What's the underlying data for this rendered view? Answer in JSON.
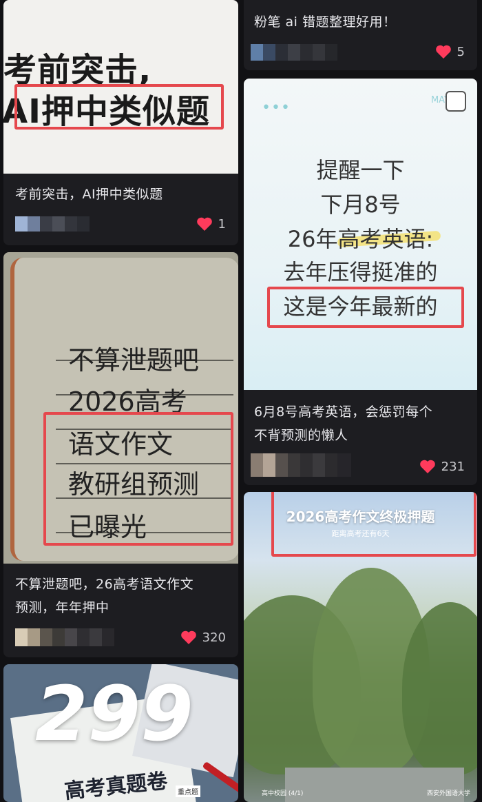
{
  "colors": {
    "background": "#111114",
    "card": "#1d1d21",
    "like_heart": "#ff3b5c",
    "highlight_box": "#e5484d"
  },
  "feed": {
    "col_left": [
      {
        "cover": {
          "line1": "考前突击,",
          "line2": "AI押中类似题"
        },
        "caption": "考前突击，AI押中类似题",
        "likes": "1"
      },
      {
        "cover": {
          "lines": [
            "不算泄题吧",
            "2026高考",
            "语文作文",
            "教研组预测",
            "已曝光"
          ]
        },
        "caption_line1": "不算泄题吧，26高考语文作文",
        "caption_line2": "预测，年年押中",
        "likes": "320"
      },
      {
        "cover": {
          "number": "299",
          "title": "高考真题卷",
          "tag": "重点题"
        }
      }
    ],
    "col_right": [
      {
        "caption": "粉笔 ai 错题整理好用！",
        "likes": "5"
      },
      {
        "cover": {
          "corner": "MAY",
          "lines": [
            "提醒一下",
            "下月8号",
            "26年高考英语:",
            "去年压得挺准的",
            "这是今年最新的"
          ]
        },
        "caption_line1": "6月8号高考英语，会惩罚每个",
        "caption_line2": "不背预测的懒人",
        "likes": "231"
      },
      {
        "cover": {
          "title": "2026高考作文终极押题",
          "subtitle": "距离高考还有6天",
          "footer_left": "高中校园 (4/1)",
          "footer_right": "西安外国语大学"
        }
      }
    ]
  }
}
